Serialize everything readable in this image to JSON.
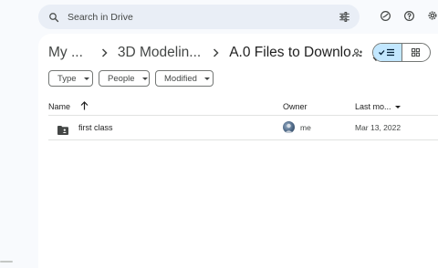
{
  "search": {
    "placeholder": "Search in Drive"
  },
  "breadcrumb": {
    "items": [
      "My ...",
      "3D Modelin...",
      "A.0 Files to Downlo..."
    ]
  },
  "filters": {
    "chips": [
      "Type",
      "People",
      "Modified"
    ]
  },
  "columns": {
    "name": "Name",
    "owner": "Owner",
    "last_modified": "Last mo..."
  },
  "rows": [
    {
      "name": "first class",
      "owner": "me",
      "modified": "Mar 13, 2022",
      "icon": "shared-folder-icon"
    }
  ],
  "colors": {
    "search_bg": "#e9eef6",
    "page_bg": "#f8fafd",
    "toggle_active": "#c2e7ff",
    "text": "#1f1f1f",
    "muted": "#444746"
  }
}
